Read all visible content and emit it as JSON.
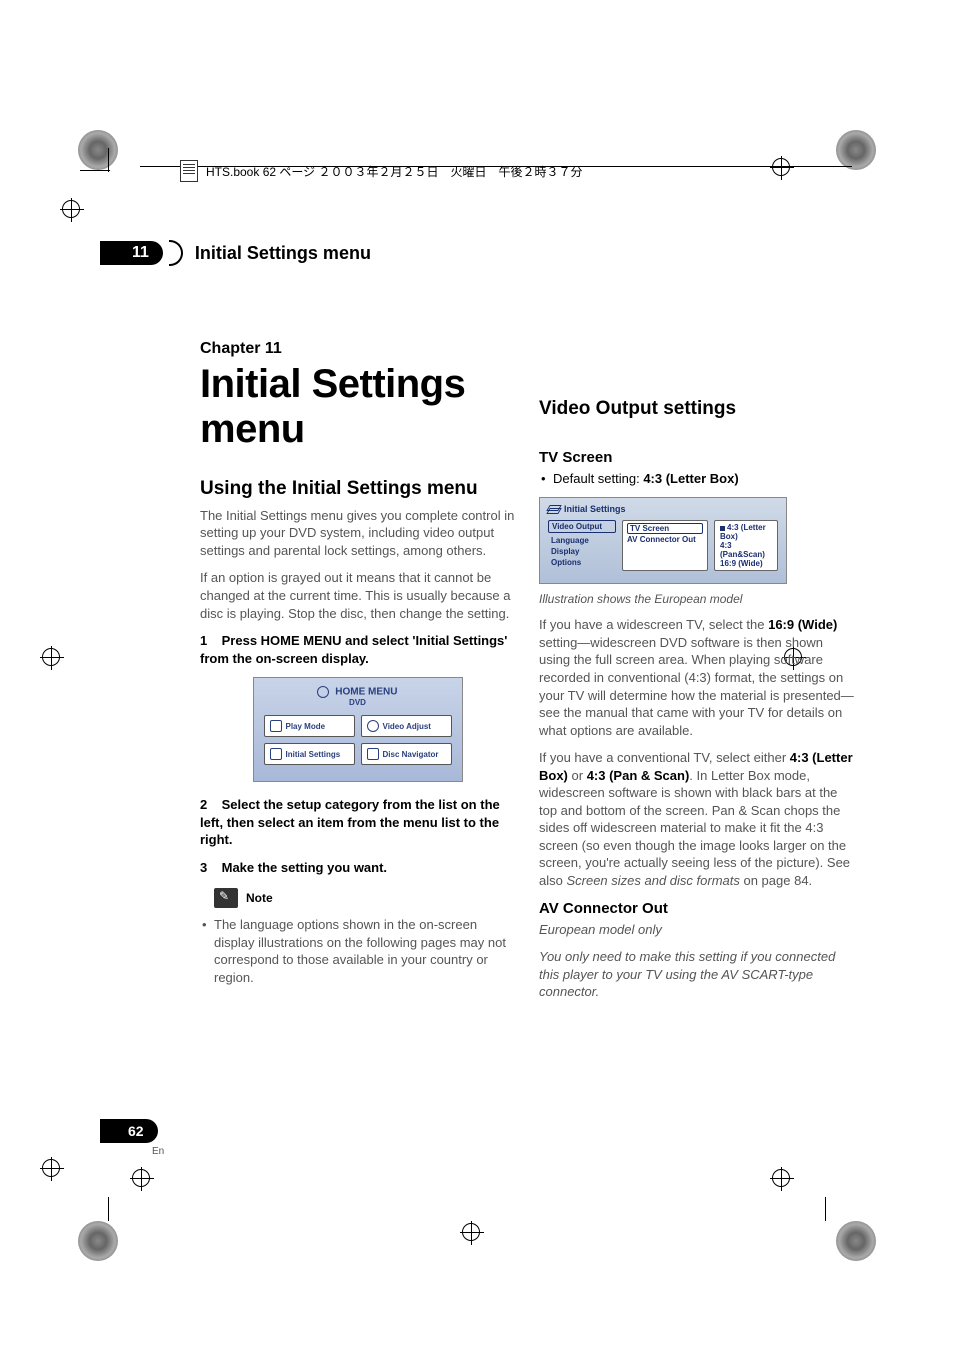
{
  "book_header": "HTS.book 62 ページ ２００３年２月２５日　火曜日　午後２時３７分",
  "tab": {
    "number": "11",
    "title": "Initial Settings menu"
  },
  "chapter": {
    "label": "Chapter 11",
    "title": "Initial Settings menu"
  },
  "left": {
    "h2": "Using the Initial Settings menu",
    "p1": "The Initial Settings menu gives you complete control in setting up your DVD system, including video output settings and parental lock settings, among others.",
    "p2": "If an option is grayed out it means that it cannot be changed at the current time. This is usually because a disc is playing. Stop the disc, then change the setting.",
    "step1_num": "1",
    "step1": "Press HOME MENU and select 'Initial Settings' from the on-screen display.",
    "home_menu": {
      "title": "HOME MENU",
      "sub": "DVD",
      "items": [
        "Play Mode",
        "Video Adjust",
        "Initial Settings",
        "Disc Navigator"
      ]
    },
    "step2_num": "2",
    "step2": "Select the setup category from the list on the left, then select an item from the menu list to the right.",
    "step3_num": "3",
    "step3": "Make the setting you want.",
    "note_label": "Note",
    "note_bullet": "The language options shown in the on-screen display illustrations on the following pages may not correspond to those available in your country or region."
  },
  "right": {
    "h2": "Video Output settings",
    "tv_h3": "TV Screen",
    "tv_default_prefix": "Default setting: ",
    "tv_default_value": "4:3 (Letter Box)",
    "settings_panel": {
      "title": "Initial Settings",
      "col1": [
        "Video Output",
        "Language",
        "Display",
        "Options"
      ],
      "col2": [
        "TV Screen",
        "AV Connector Out"
      ],
      "col3": [
        "4:3 (Letter Box)",
        "4:3 (Pan&Scan)",
        "16:9 (Wide)"
      ]
    },
    "caption": "Illustration shows the European model",
    "p_wide_1": "If you have a widescreen TV, select the ",
    "p_wide_bold": "16:9 (Wide)",
    "p_wide_2": " setting—widescreen DVD software is then shown using the full screen area. When playing software recorded in conventional (4:3) format, the settings on your TV will determine how the material is presented—see the manual that came with your TV for details on what options are available.",
    "p_conv_1": "If you have a conventional TV, select either ",
    "p_conv_b1": "4:3 (Letter Box)",
    "p_conv_or": " or ",
    "p_conv_b2": "4:3 (Pan & Scan)",
    "p_conv_2": ". In Letter Box mode, widescreen software is shown with black bars at the top and bottom of the screen. Pan & Scan chops the sides off widescreen material to make it fit the 4:3 screen (so even though the image looks larger on the screen, you're actually seeing less of the picture). See also ",
    "p_conv_i": "Screen sizes and disc formats",
    "p_conv_3": " on page 84.",
    "av_h3": "AV Connector Out",
    "av_i1": "European model only",
    "av_i2": "You only need to make this setting if you connected this player to your TV using the AV SCART-type connector."
  },
  "page": {
    "num": "62",
    "lang": "En"
  }
}
